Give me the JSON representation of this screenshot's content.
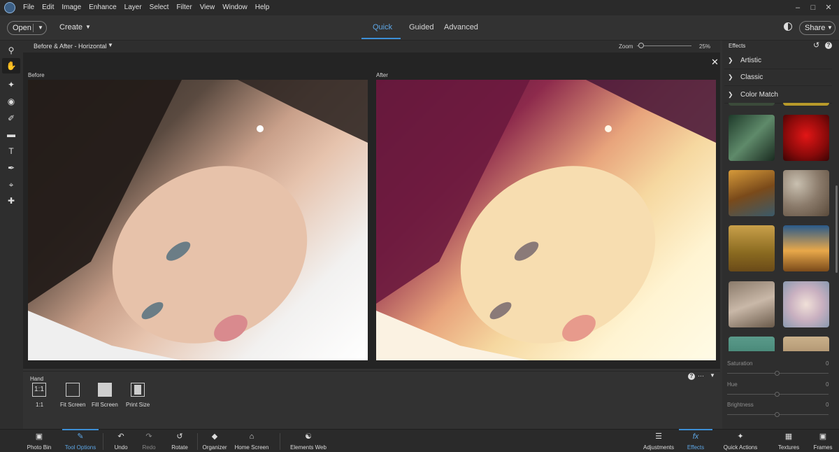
{
  "menubar": {
    "items": [
      "File",
      "Edit",
      "Image",
      "Enhance",
      "Layer",
      "Select",
      "Filter",
      "View",
      "Window",
      "Help"
    ]
  },
  "toolbar": {
    "open_label": "Open",
    "create_label": "Create",
    "modes": [
      {
        "label": "Quick",
        "active": true
      },
      {
        "label": "Guided",
        "active": false
      },
      {
        "label": "Advanced",
        "active": false
      }
    ],
    "share_label": "Share"
  },
  "view": {
    "mode_label": "Before & After - Horizontal",
    "zoom_label": "Zoom",
    "zoom_value": "25%",
    "before_label": "Before",
    "after_label": "After"
  },
  "tool_options": {
    "tool_name": "Hand",
    "buttons": [
      {
        "label": "1:1",
        "icon": "one-to-one-icon"
      },
      {
        "label": "Fit Screen",
        "icon": "fit-screen-icon"
      },
      {
        "label": "Fill Screen",
        "icon": "fill-screen-icon"
      },
      {
        "label": "Print Size",
        "icon": "print-size-icon"
      }
    ],
    "one_to_one_glyph": "1:1"
  },
  "effects_panel": {
    "title": "Effects",
    "categories": [
      {
        "label": "Artistic",
        "expanded": false
      },
      {
        "label": "Classic",
        "expanded": false
      },
      {
        "label": "Color Match",
        "expanded": true
      }
    ],
    "sliders": [
      {
        "label": "Saturation",
        "value": "0"
      },
      {
        "label": "Hue",
        "value": "0"
      },
      {
        "label": "Brightness",
        "value": "0"
      }
    ]
  },
  "bottom_bar": {
    "items": [
      {
        "label": "Photo Bin",
        "icon": "photo-bin-icon",
        "active": false
      },
      {
        "label": "Tool Options",
        "icon": "tool-options-icon",
        "active": true
      },
      {
        "label": "Undo",
        "icon": "undo-icon",
        "active": false
      },
      {
        "label": "Redo",
        "icon": "redo-icon",
        "active": false
      },
      {
        "label": "Rotate",
        "icon": "rotate-icon",
        "active": false
      },
      {
        "label": "Organizer",
        "icon": "organizer-icon",
        "active": false
      },
      {
        "label": "Home Screen",
        "icon": "home-icon",
        "active": false
      },
      {
        "label": "Elements Web",
        "icon": "globe-icon",
        "active": false
      },
      {
        "label": "Adjustments",
        "icon": "adjustments-icon",
        "active": false
      },
      {
        "label": "Effects",
        "icon": "fx-icon",
        "active": true
      },
      {
        "label": "Quick Actions",
        "icon": "quick-actions-icon",
        "active": false
      },
      {
        "label": "Textures",
        "icon": "textures-icon",
        "active": false
      },
      {
        "label": "Frames",
        "icon": "frames-icon",
        "active": false
      }
    ]
  },
  "colors": {
    "accent": "#3c8fd6",
    "panel_bg": "#323232",
    "canvas_bg": "#242424"
  }
}
